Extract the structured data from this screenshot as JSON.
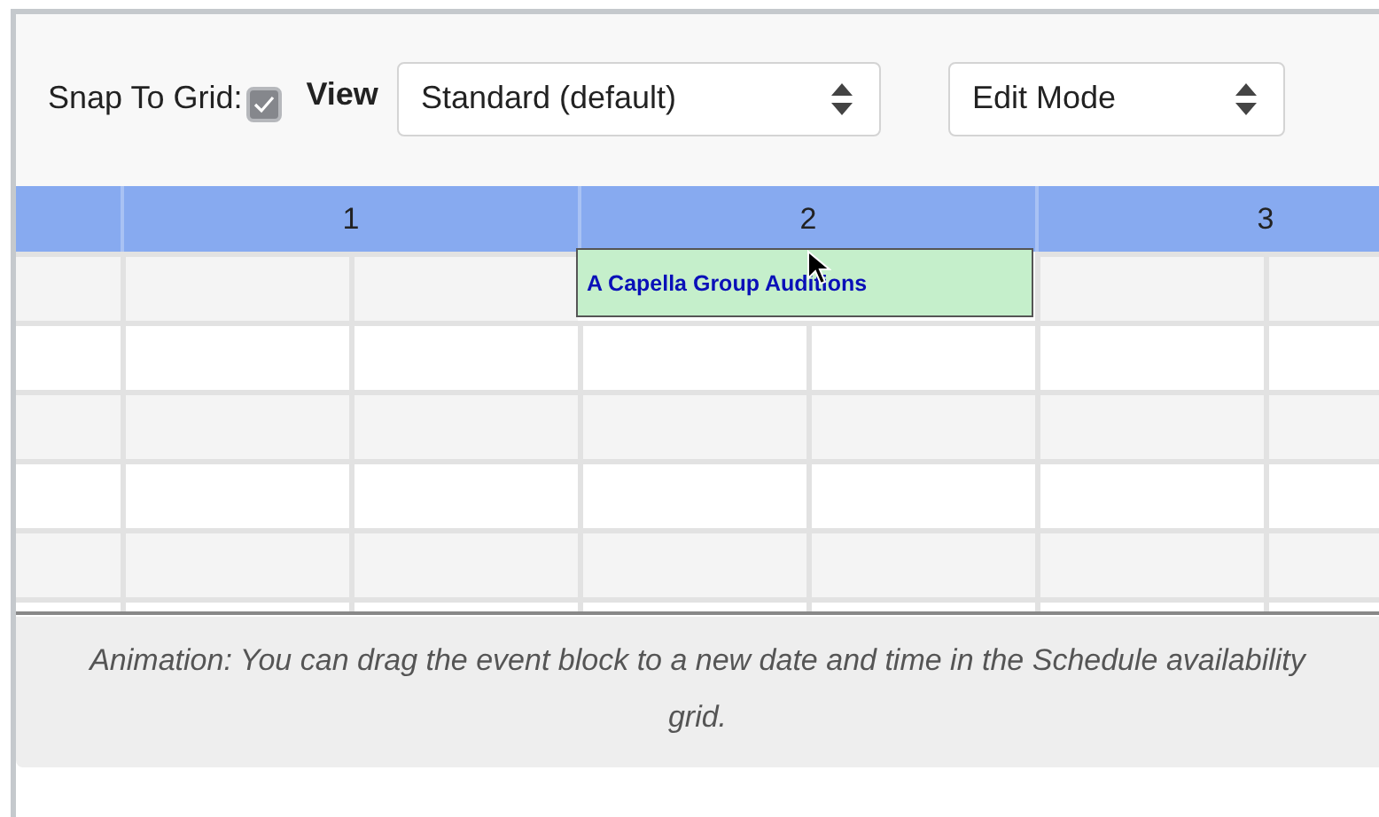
{
  "toolbar": {
    "snap_label": "Snap To Grid:",
    "snap_checked": true,
    "view_label": "View",
    "view_select": {
      "value": "Standard (default)"
    },
    "mode_select": {
      "value": "Edit Mode"
    }
  },
  "grid": {
    "columns": [
      {
        "label": "1"
      },
      {
        "label": "2",
        "events": [
          {
            "title": "A Capella Group Auditions"
          }
        ]
      },
      {
        "label": "3"
      }
    ]
  },
  "caption": "Animation: You can drag the event block to a new date and time in the Schedule availability grid."
}
